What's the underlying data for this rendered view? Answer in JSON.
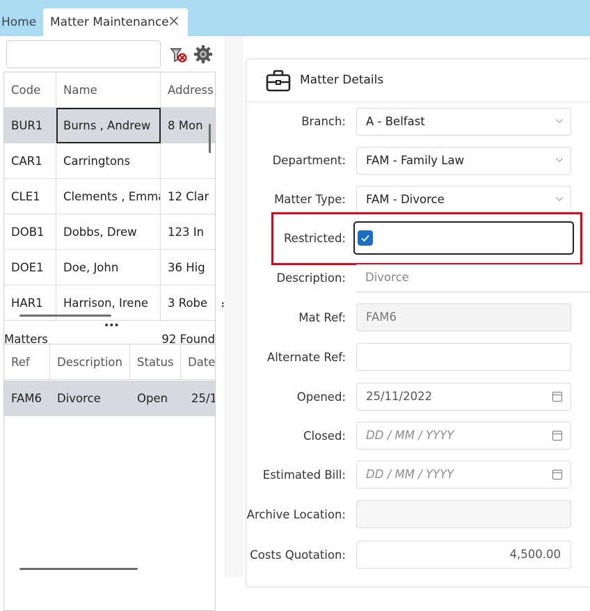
{
  "tabs": {
    "home_label": "Home",
    "matter_label": "Matter Maintenance"
  },
  "clients": {
    "columns": [
      "Code",
      "Name",
      "Address"
    ],
    "rows": [
      {
        "code": "BUR1",
        "name": "Burns , Andrew",
        "address": "8 Mon"
      },
      {
        "code": "CAR1",
        "name": "Carringtons",
        "address": ""
      },
      {
        "code": "CLE1",
        "name": "Clements , Emma",
        "address": "12 Clar"
      },
      {
        "code": "DOB1",
        "name": "Dobbs, Drew",
        "address": "123 In"
      },
      {
        "code": "DOE1",
        "name": "Doe, John",
        "address": "36 Hig"
      },
      {
        "code": "HAR1",
        "name": "Harrison, Irene",
        "address": "3 Robe"
      }
    ]
  },
  "matters": {
    "label": "Matters",
    "count": "92 Found",
    "columns": [
      "Ref",
      "Description",
      "Status",
      "Date"
    ],
    "rows": [
      {
        "ref": "FAM6",
        "description": "Divorce",
        "status": "Open",
        "date": "25/1"
      }
    ]
  },
  "details": {
    "title": "Matter Details",
    "branch": {
      "label": "Branch:",
      "value": "A - Belfast"
    },
    "department": {
      "label": "Department:",
      "value": "FAM - Family Law"
    },
    "matter_type": {
      "label": "Matter Type:",
      "value": "FAM - Divorce"
    },
    "restricted": {
      "label": "Restricted:",
      "checked": true
    },
    "description": {
      "label": "Description:",
      "value": "Divorce"
    },
    "mat_ref": {
      "label": "Mat Ref:",
      "value": "FAM6"
    },
    "alternate_ref": {
      "label": "Alternate Ref:",
      "value": ""
    },
    "opened": {
      "label": "Opened:",
      "value": "25/11/2022"
    },
    "closed": {
      "label": "Closed:",
      "placeholder": "DD / MM / YYYY"
    },
    "estimated_bill": {
      "label": "Estimated Bill:",
      "placeholder": "DD / MM / YYYY"
    },
    "archive_location": {
      "label": "Archive Location:",
      "value": ""
    },
    "costs_quotation": {
      "label": "Costs Quotation:",
      "value": "4,500.00"
    }
  },
  "colors": {
    "tabbar": "#a9dbf2",
    "checkbox": "#1a6fc4",
    "highlight": "#e3001b"
  },
  "icons": [
    "filter-clear-icon",
    "gear-icon",
    "briefcase-icon",
    "close-icon",
    "chevron-down-icon",
    "calendar-icon",
    "checkmark-icon"
  ]
}
